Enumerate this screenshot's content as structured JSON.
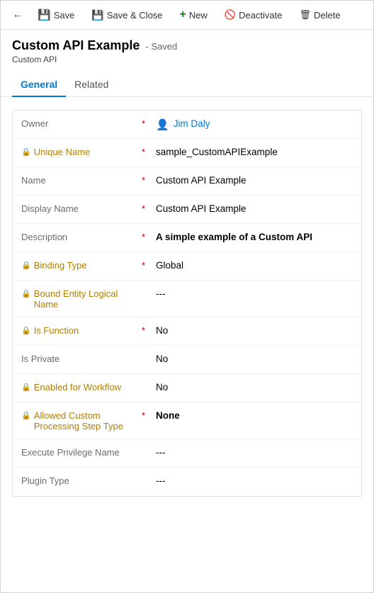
{
  "toolbar": {
    "back_icon": "←",
    "save_label": "Save",
    "save_close_label": "Save & Close",
    "new_label": "New",
    "deactivate_label": "Deactivate",
    "delete_label": "Delete"
  },
  "header": {
    "title": "Custom API Example",
    "saved_status": "- Saved",
    "subtitle": "Custom API"
  },
  "tabs": [
    {
      "label": "General",
      "active": true
    },
    {
      "label": "Related",
      "active": false
    }
  ],
  "fields": [
    {
      "label": "Owner",
      "locked": false,
      "required": true,
      "value": "Jim Daly",
      "type": "user"
    },
    {
      "label": "Unique Name",
      "locked": true,
      "required": true,
      "value": "sample_CustomAPIExample",
      "type": "text"
    },
    {
      "label": "Name",
      "locked": false,
      "required": true,
      "value": "Custom API Example",
      "type": "text"
    },
    {
      "label": "Display Name",
      "locked": false,
      "required": true,
      "value": "Custom API Example",
      "type": "text"
    },
    {
      "label": "Description",
      "locked": false,
      "required": true,
      "value": "A simple example of a Custom API",
      "type": "bold"
    },
    {
      "label": "Binding Type",
      "locked": true,
      "required": true,
      "value": "Global",
      "type": "text"
    },
    {
      "label": "Bound Entity Logical Name",
      "locked": true,
      "required": false,
      "value": "---",
      "type": "text"
    },
    {
      "label": "Is Function",
      "locked": true,
      "required": true,
      "value": "No",
      "type": "text"
    },
    {
      "label": "Is Private",
      "locked": false,
      "required": false,
      "value": "No",
      "type": "text"
    },
    {
      "label": "Enabled for Workflow",
      "locked": true,
      "required": false,
      "value": "No",
      "type": "text"
    },
    {
      "label": "Allowed Custom Processing Step Type",
      "locked": true,
      "required": true,
      "value": "None",
      "type": "bold"
    },
    {
      "label": "Execute Privilege Name",
      "locked": false,
      "required": false,
      "value": "---",
      "type": "text"
    },
    {
      "label": "Plugin Type",
      "locked": false,
      "required": false,
      "value": "---",
      "type": "text"
    }
  ]
}
